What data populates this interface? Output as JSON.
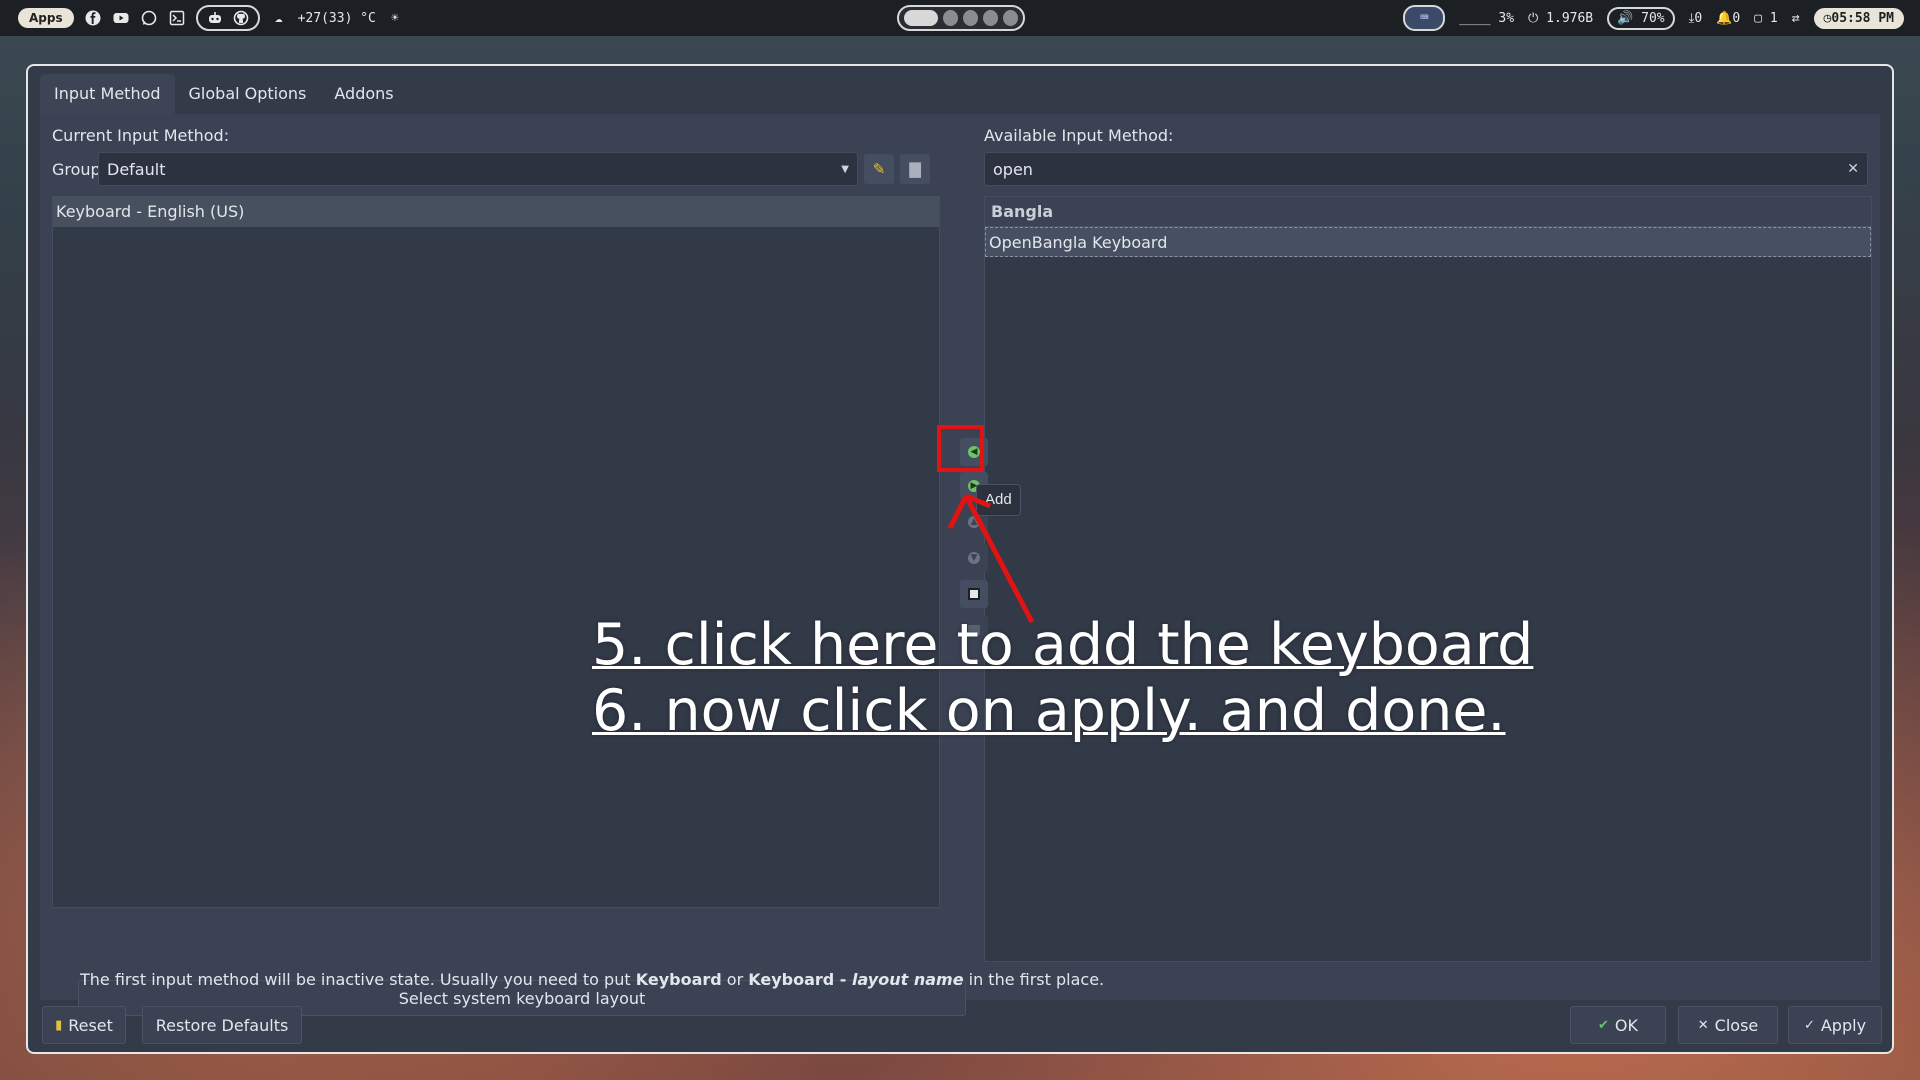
{
  "topbar": {
    "apps_label": "Apps",
    "weather": "+27(33) °C",
    "network_usage": "3%",
    "memory": "1.976B",
    "volume": "70%",
    "downloads": "0",
    "notifications": "0",
    "windows": "1",
    "clock": "05:58 PM"
  },
  "dialog": {
    "tabs": [
      "Input Method",
      "Global Options",
      "Addons"
    ],
    "current_label": "Current Input Method:",
    "group_label": "Group:",
    "group_value": "Default",
    "current_list": [
      "Keyboard - English (US)"
    ],
    "available_label": "Available Input Method:",
    "search_value": "open",
    "available_group_header": "Bangla",
    "available_list": [
      "OpenBangla Keyboard"
    ],
    "tooltip": "Add",
    "select_layout_button": "Select system keyboard layout",
    "hint_prefix": "The first input method will be inactive state. Usually you need to put ",
    "hint_kbd": "Keyboard",
    "hint_or": " or ",
    "hint_kbd2": "Keyboard - ",
    "hint_layout": "layout name",
    "hint_suffix": " in the first place.",
    "reset_button": "Reset",
    "restore_button": "Restore Defaults",
    "ok_button": "OK",
    "close_button": "Close",
    "apply_button": "Apply"
  },
  "annotation": {
    "line1": "5. click here to add the keyboard",
    "line2": "6. now click on apply. and done."
  },
  "colors": {
    "dialog_bg": "#333a48",
    "highlight": "#e31313",
    "accent_green": "#6cc36a"
  }
}
